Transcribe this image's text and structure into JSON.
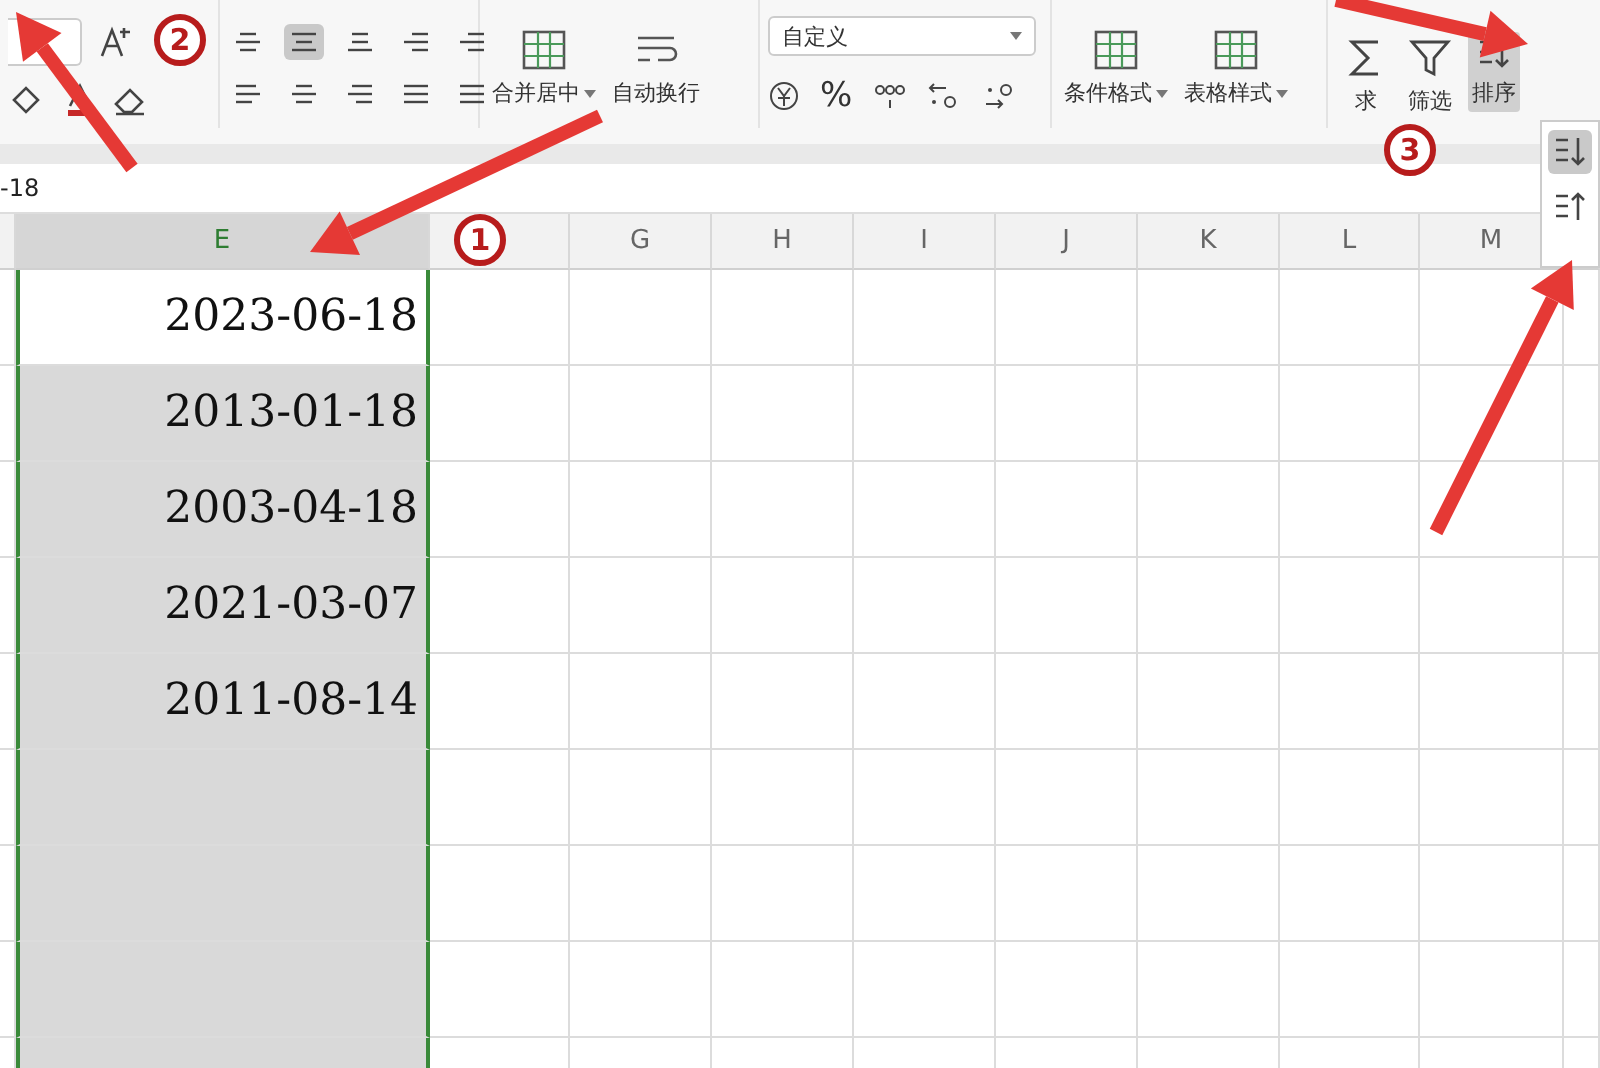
{
  "ribbon": {
    "merge_button": {
      "label": "合并居中"
    },
    "wrap_button": {
      "label": "自动换行"
    },
    "number_format": {
      "value": "自定义"
    },
    "number_buttons": [
      "%"
    ],
    "style_buttons": [
      {
        "label": "条件格式"
      },
      {
        "label": "表格样式"
      }
    ],
    "data_buttons": [
      {
        "label": "求",
        "kind": "sum"
      },
      {
        "label": "筛选",
        "kind": "filter"
      },
      {
        "label": "排序",
        "kind": "sort",
        "selected": true
      }
    ],
    "align_buttons": [
      {
        "selected": false
      },
      {
        "selected": true
      },
      {
        "selected": false
      },
      {
        "selected": false
      },
      {
        "selected": false
      },
      {
        "selected": false
      },
      {
        "selected": false
      },
      {
        "selected": false
      },
      {
        "selected": false
      },
      {
        "selected": false
      }
    ]
  },
  "sort_menu": {
    "items": [
      {
        "kind": "ascending",
        "selected": true
      },
      {
        "kind": "descending",
        "selected": false
      }
    ]
  },
  "formula_bar": {
    "value": "-18"
  },
  "columns": [
    {
      "selected": false
    },
    {
      "label": "E",
      "selected": true
    },
    {
      "selected": false
    },
    {
      "label": "G",
      "selected": false
    },
    {
      "label": "H",
      "selected": false
    },
    {
      "label": "I",
      "selected": false
    },
    {
      "label": "J",
      "selected": false
    },
    {
      "label": "K",
      "selected": false
    },
    {
      "label": "L",
      "selected": false
    },
    {
      "label": "M",
      "selected": false
    },
    {}
  ],
  "cells": [
    "2023-06-18",
    "2013-01-18",
    "2003-04-18",
    "2021-03-07",
    "2011-08-14",
    "",
    "",
    "",
    ""
  ],
  "callouts": [
    {
      "number": "1"
    },
    {
      "number": "2"
    },
    {
      "number": "3"
    }
  ]
}
